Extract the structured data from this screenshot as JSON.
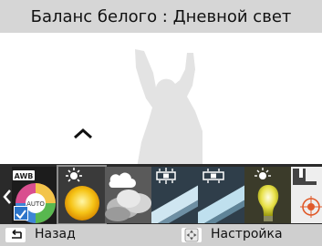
{
  "title": "Баланс белого : Дневной свет",
  "presets": [
    {
      "name": "awb",
      "badge": "AWB",
      "sub": "AUTO"
    },
    {
      "name": "daylight"
    },
    {
      "name": "cloudy"
    },
    {
      "name": "fluorescent-h"
    },
    {
      "name": "fluorescent-l"
    },
    {
      "name": "tungsten"
    },
    {
      "name": "custom"
    }
  ],
  "selected_preset": "daylight",
  "bottom": {
    "back_label": "Назад",
    "settings_label": "Настройка"
  },
  "colors": {
    "title_bg": "#d6d6d6",
    "strip_bg": "#2a2a2a",
    "bottom_bg": "#cfcfcf",
    "check_blue": "#2c74c9"
  }
}
